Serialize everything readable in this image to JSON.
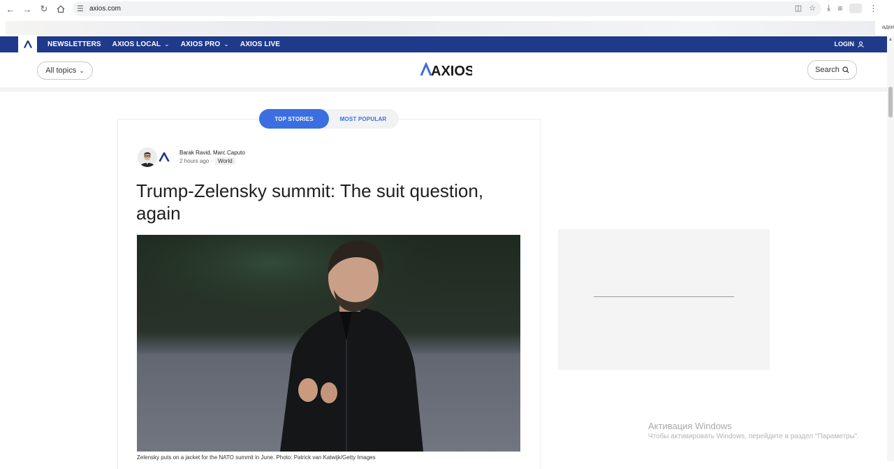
{
  "browser": {
    "url": "axios.com",
    "bookmark_tail": "адки"
  },
  "nav": {
    "links": [
      {
        "label": "NEWSLETTERS"
      },
      {
        "label": "AXIOS LOCAL"
      },
      {
        "label": "AXIOS PRO"
      },
      {
        "label": "AXIOS LIVE"
      }
    ],
    "login": "LOGIN",
    "color": "#1f3a8a"
  },
  "header": {
    "all_topics": "All topics",
    "logo": "AXIOS",
    "search": "Search"
  },
  "tabs": {
    "top_stories": "TOP STORIES",
    "most_popular": "MOST POPULAR"
  },
  "article": {
    "authors": "Barak Ravid, Marc Caputo",
    "time": "2 hours ago",
    "separator": "·",
    "tag": "World",
    "headline": "Trump-Zelensky summit: The suit question, again",
    "caption": "Zelensky puts on a jacket for the NATO summit in June. Photo: Patrick van Katwijk/Getty Images"
  },
  "watermark": {
    "title": "Активация Windows",
    "subtitle": "Чтобы активировать Windows, перейдите в раздел \"Параметры\"."
  },
  "colors": {
    "accent": "#3b6ee0",
    "brand_navy": "#1f3a8a"
  }
}
